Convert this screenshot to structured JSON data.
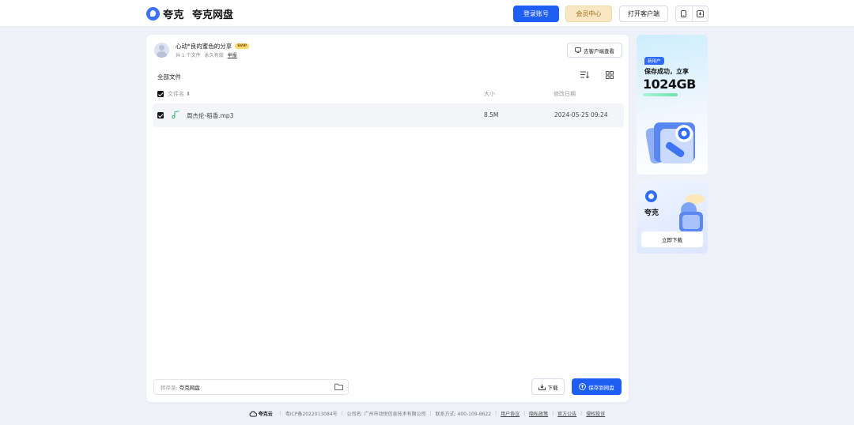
{
  "header": {
    "logo_text": "夸克",
    "product_name": "夸克网盘",
    "login_label": "登录账号",
    "vip_label": "会员中心",
    "client_label": "打开客户端",
    "icons": [
      "phone-icon",
      "download-app-icon"
    ]
  },
  "share": {
    "title": "心动*良的蜜色的分享",
    "badge": "SVIP",
    "file_count": "共 1 个文件",
    "validity": "永久有效",
    "report": "举报",
    "view_in_client": "去客户端查看"
  },
  "file_list": {
    "breadcrumb": "全部文件",
    "columns": {
      "name": "文件名",
      "size": "大小",
      "date": "修改日期"
    },
    "rows": [
      {
        "name": "周杰伦-稻香.mp3",
        "size": "8.5M",
        "date": "2024-05-25 09:24",
        "icon": "music-file-icon",
        "checked": true
      }
    ]
  },
  "actions": {
    "save_to_label": "转存至:",
    "save_to_value": "夸克网盘",
    "download_label": "下载",
    "save_label": "保存到网盘"
  },
  "promo1": {
    "tag": "新用户",
    "line1": "保存成功，立享",
    "big": "1024GB"
  },
  "promo2": {
    "name": "夸克",
    "button": "立即下载"
  },
  "footer": {
    "brand": "夸克云",
    "icp": "粤ICP备2022013084号",
    "company": "公司名: 广州市动悦信息技术有限公司",
    "contact": "联系方式: 400-109-8622",
    "links": [
      "用户协议",
      "隐私政策",
      "官方公告",
      "侵权投诉"
    ]
  },
  "colors": {
    "accent": "#1f5ef2",
    "vip": "#f8e7c2",
    "background": "#eef1f8"
  }
}
